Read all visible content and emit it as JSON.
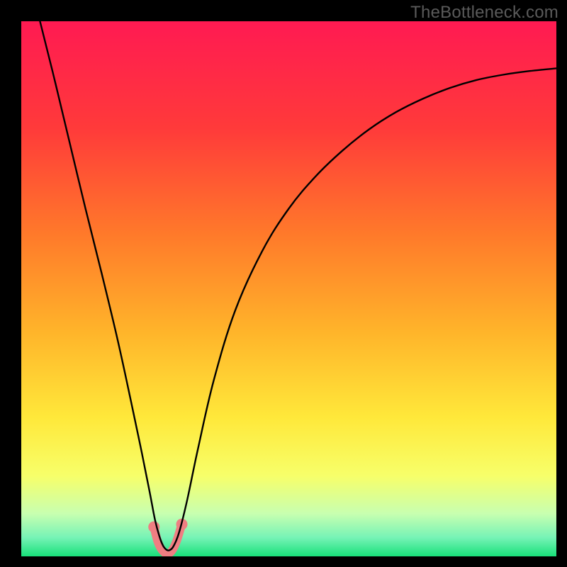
{
  "watermark": "TheBottleneck.com",
  "chart_data": {
    "type": "line",
    "title": "",
    "xlabel": "",
    "ylabel": "",
    "xlim": [
      0,
      1
    ],
    "ylim": [
      0,
      1
    ],
    "background_gradient": {
      "stops": [
        {
          "offset": 0.0,
          "color": "#ff1a52"
        },
        {
          "offset": 0.2,
          "color": "#ff3a3a"
        },
        {
          "offset": 0.4,
          "color": "#ff7a2a"
        },
        {
          "offset": 0.58,
          "color": "#ffb42a"
        },
        {
          "offset": 0.74,
          "color": "#ffe83a"
        },
        {
          "offset": 0.85,
          "color": "#f7ff6a"
        },
        {
          "offset": 0.92,
          "color": "#c8ffb0"
        },
        {
          "offset": 0.965,
          "color": "#76f3b6"
        },
        {
          "offset": 1.0,
          "color": "#18e07a"
        }
      ]
    },
    "series": [
      {
        "name": "bottleneck-curve",
        "color": "#000000",
        "stroke_width": 2.4,
        "x": [
          0.035,
          0.06,
          0.09,
          0.12,
          0.15,
          0.18,
          0.205,
          0.225,
          0.24,
          0.25,
          0.258,
          0.265,
          0.272,
          0.278,
          0.285,
          0.295,
          0.31,
          0.33,
          0.36,
          0.4,
          0.45,
          0.5,
          0.55,
          0.6,
          0.65,
          0.7,
          0.75,
          0.8,
          0.85,
          0.9,
          0.95,
          1.0
        ],
        "y": [
          1.0,
          0.9,
          0.775,
          0.65,
          0.53,
          0.405,
          0.29,
          0.195,
          0.12,
          0.068,
          0.038,
          0.02,
          0.012,
          0.012,
          0.02,
          0.045,
          0.105,
          0.2,
          0.33,
          0.46,
          0.57,
          0.65,
          0.71,
          0.758,
          0.798,
          0.83,
          0.855,
          0.875,
          0.89,
          0.9,
          0.907,
          0.912
        ]
      }
    ],
    "marker_region": {
      "name": "optimal-zone",
      "color": "#ef7e82",
      "stroke_width": 12,
      "points": [
        {
          "x": 0.248,
          "y": 0.055
        },
        {
          "x": 0.255,
          "y": 0.028
        },
        {
          "x": 0.263,
          "y": 0.012
        },
        {
          "x": 0.272,
          "y": 0.005
        },
        {
          "x": 0.281,
          "y": 0.01
        },
        {
          "x": 0.29,
          "y": 0.028
        },
        {
          "x": 0.3,
          "y": 0.06
        }
      ],
      "dot_radius": 8
    }
  }
}
